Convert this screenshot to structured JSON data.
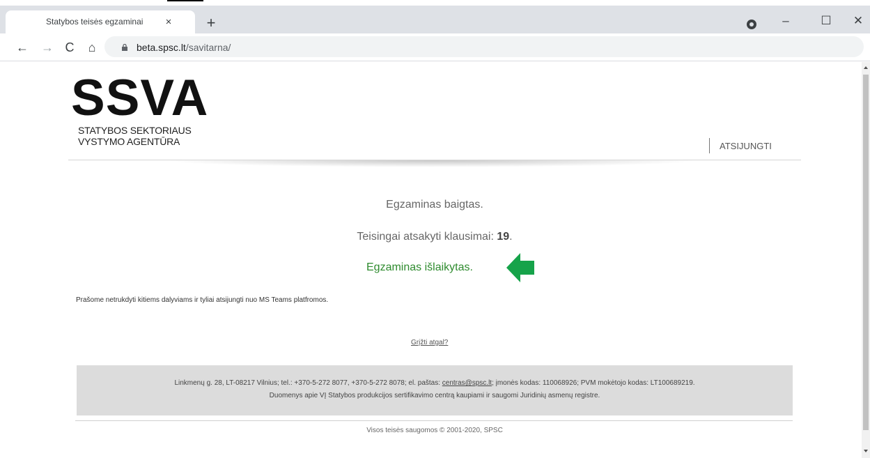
{
  "browser": {
    "tab_title": "Statybos teisės egzaminai",
    "tab_close": "×",
    "new_tab": "+",
    "url_host": "beta.spsc.lt",
    "url_path": "/savitarna/",
    "window_min": "–",
    "window_max": "☐",
    "window_close": "✕",
    "icons": {
      "back": "←",
      "forward": "→",
      "reload": "C",
      "home": "⌂"
    }
  },
  "header": {
    "logo_main": "SSVA",
    "logo_line1": "STATYBOS SEKTORIAUS",
    "logo_line2": "VYSTYMO AGENTŪRA",
    "logout_label": "ATSIJUNGTI"
  },
  "result": {
    "finished": "Egzaminas baigtas.",
    "correct_label": "Teisingai atsakyti klausimai: ",
    "correct_count": "19",
    "correct_suffix": ".",
    "passed": "Egzaminas išlaikytas.",
    "arrow_color": "#16a34a"
  },
  "notice": "Prašome netrukdyti kitiems dalyviams ir tyliai atsijungti nuo MS Teams platfromos.",
  "back_link": "Grįžti atgal?",
  "footer": {
    "line1_pre": "Linkmenų g. 28, LT-08217 Vilnius; tel.: +370-5-272 8077, +370-5-272 8078; el. paštas: ",
    "email": "centras@spsc.lt",
    "line1_post": "; įmonės kodas: 110068926; PVM mokėtojo kodas: LT100689219.",
    "line2": "Duomenys apie VĮ Statybos produkcijos sertifikavimo centrą kaupiami ir saugomi Juridinių asmenų registre.",
    "copyright": "Visos teisės saugomos © 2001-2020, SPSC"
  }
}
